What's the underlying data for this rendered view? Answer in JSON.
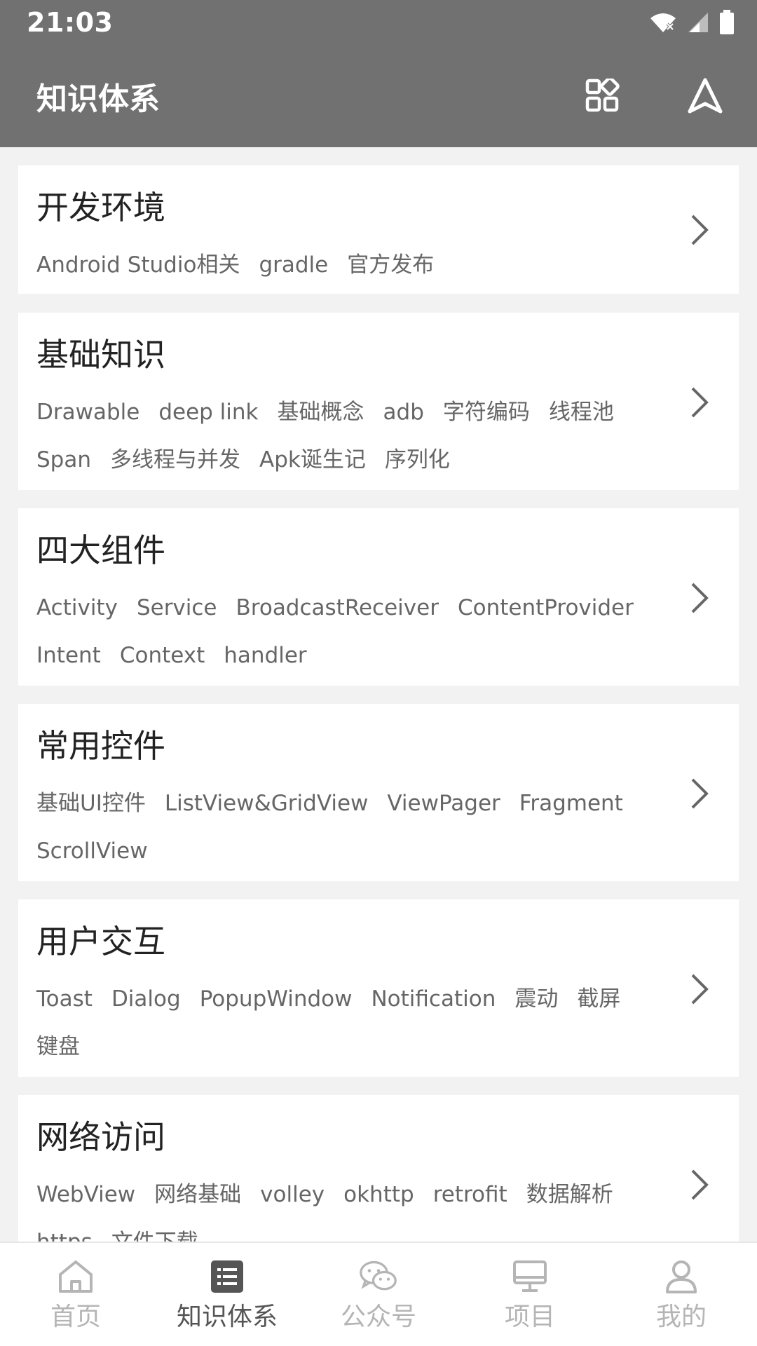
{
  "status_bar": {
    "time": "21:03"
  },
  "app_bar": {
    "title": "知识体系"
  },
  "categories": [
    {
      "title": "开发环境",
      "tags": [
        "Android Studio相关",
        "gradle",
        "官方发布"
      ]
    },
    {
      "title": "基础知识",
      "tags": [
        "Drawable",
        "deep link",
        "基础概念",
        "adb",
        "字符编码",
        "线程池",
        "Span",
        "多线程与并发",
        "Apk诞生记",
        "序列化"
      ]
    },
    {
      "title": "四大组件",
      "tags": [
        "Activity",
        "Service",
        "BroadcastReceiver",
        "ContentProvider",
        "Intent",
        "Context",
        "handler"
      ]
    },
    {
      "title": "常用控件",
      "tags": [
        "基础UI控件",
        "ListView&GridView",
        "ViewPager",
        "Fragment",
        "ScrollView"
      ]
    },
    {
      "title": "用户交互",
      "tags": [
        "Toast",
        "Dialog",
        "PopupWindow",
        "Notification",
        "震动",
        "截屏",
        "键盘"
      ]
    },
    {
      "title": "网络访问",
      "tags": [
        "WebView",
        "网络基础",
        "volley",
        "okhttp",
        "retrofit",
        "数据解析",
        "https",
        "文件下载"
      ]
    }
  ],
  "bottom_nav": {
    "items": [
      {
        "label": "首页",
        "icon": "home-icon"
      },
      {
        "label": "知识体系",
        "icon": "list-icon"
      },
      {
        "label": "公众号",
        "icon": "wechat-icon"
      },
      {
        "label": "项目",
        "icon": "monitor-icon"
      },
      {
        "label": "我的",
        "icon": "person-icon"
      }
    ],
    "active_index": 1
  },
  "colors": {
    "app_bar": "#717171",
    "background": "#f2f2f2",
    "card": "#ffffff",
    "tag_text": "#666666",
    "nav_inactive": "#b5b5b5",
    "nav_active": "#555555"
  }
}
